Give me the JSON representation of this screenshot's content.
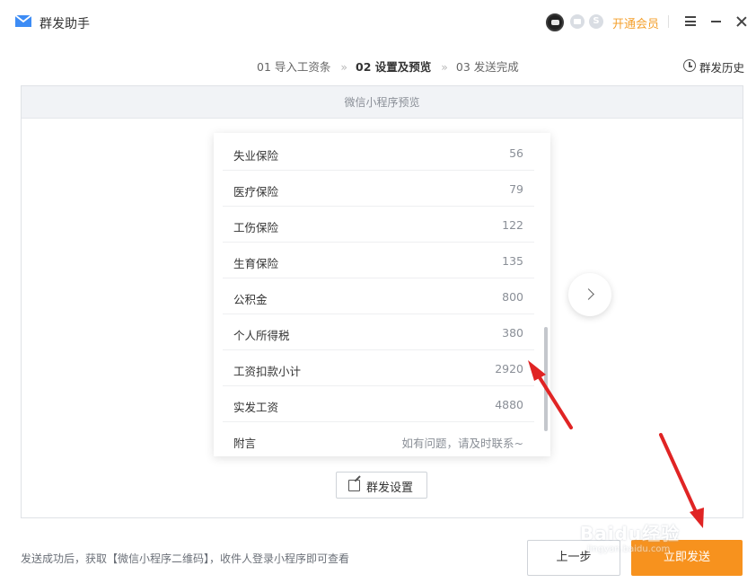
{
  "app": {
    "title": "群发助手",
    "vip_label": "开通会员",
    "badge_s": "S"
  },
  "steps": [
    {
      "label": "01 导入工资条",
      "active": false
    },
    {
      "label": "02 设置及预览",
      "active": true
    },
    {
      "label": "03 发送完成",
      "active": false
    }
  ],
  "step_separator": "»",
  "history_label": "群发历史",
  "preview": {
    "header": "微信小程序预览",
    "rows": [
      {
        "key": "失业保险",
        "value": "56"
      },
      {
        "key": "医疗保险",
        "value": "79"
      },
      {
        "key": "工伤保险",
        "value": "122"
      },
      {
        "key": "生育保险",
        "value": "135"
      },
      {
        "key": "公积金",
        "value": "800"
      },
      {
        "key": "个人所得税",
        "value": "380"
      },
      {
        "key": "工资扣款小计",
        "value": "2920"
      },
      {
        "key": "实发工资",
        "value": "4880"
      },
      {
        "key": "附言",
        "value": "如有问题，请及时联系~"
      }
    ],
    "settings_button": "群发设置"
  },
  "footer": {
    "note": "发送成功后，获取【微信小程序二维码】，收件人登录小程序即可查看",
    "prev_button": "上一步",
    "send_button": "立即发送"
  },
  "watermark": {
    "text": "Baidu经验",
    "sub": "jingyan.baidu.com"
  },
  "colors": {
    "accent": "#f7921e",
    "vip": "#f4a02d",
    "arrow": "#e02424",
    "logo": "#3d8cf5"
  }
}
